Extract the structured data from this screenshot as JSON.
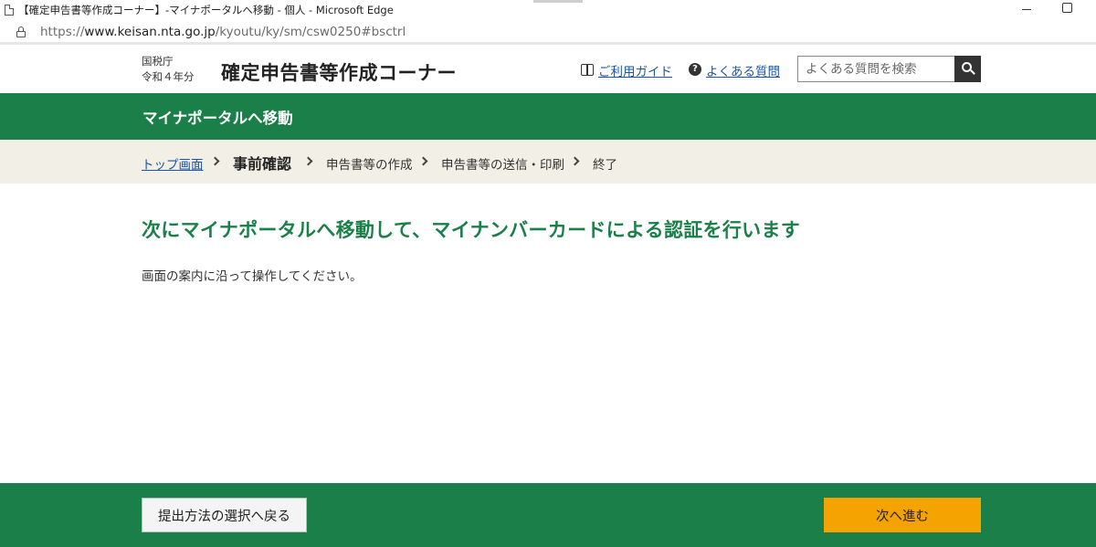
{
  "window": {
    "title": "【確定申告書等作成コーナー】-マイナポータルへ移動 - 個人 - Microsoft Edge"
  },
  "address_bar": {
    "url_scheme": "https://",
    "url_host": "www.keisan.nta.go.jp",
    "url_path": "/kyoutu/ky/sm/csw0250#bsctrl"
  },
  "header": {
    "agency": "国税庁",
    "year": "令和４年分",
    "site_title": "確定申告書等作成コーナー",
    "guide_link": "ご利用ガイド",
    "faq_link": "よくある質問",
    "search_placeholder": "よくある質問を検索",
    "icons": [
      "book-icon",
      "question-circle-icon",
      "search-icon"
    ]
  },
  "banner": {
    "title": "マイナポータルへ移動"
  },
  "steps": {
    "top": "トップ画面",
    "current": "事前確認",
    "create": "申告書等の作成",
    "send": "申告書等の送信・印刷",
    "end": "終了"
  },
  "main": {
    "heading": "次にマイナポータルへ移動して、マイナンバーカードによる認証を行います",
    "instruction": "画面の案内に沿って操作してください。"
  },
  "footer": {
    "back_label": "提出方法の選択へ戻る",
    "next_label": "次へ進む"
  },
  "colors": {
    "brand_green": "#1b7f49",
    "next_button": "#f5a300",
    "steps_background": "#f1efe6",
    "link": "#1a56a8"
  }
}
